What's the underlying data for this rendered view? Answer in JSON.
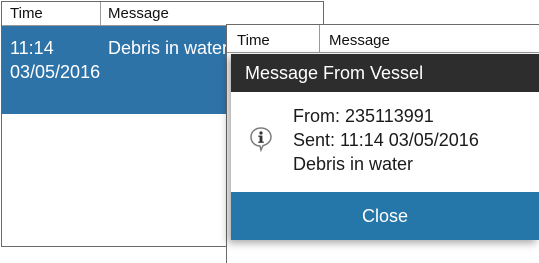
{
  "back_list": {
    "header": {
      "time": "Time",
      "message": "Message"
    },
    "selected_row": {
      "time_line1": "11:14",
      "time_line2": "03/05/2016",
      "message": "Debris in water"
    }
  },
  "front_list": {
    "header": {
      "time": "Time",
      "message": "Message"
    }
  },
  "dialog": {
    "title": "Message From Vessel",
    "icon": "info-icon",
    "from": "From: 235113991",
    "sent": "Sent: 11:14 03/05/2016",
    "message": "Debris in water",
    "close_label": "Close"
  },
  "colors": {
    "selection": "#2e73a8",
    "title_bar": "#2d2d2d",
    "close_button": "#2576a9"
  }
}
